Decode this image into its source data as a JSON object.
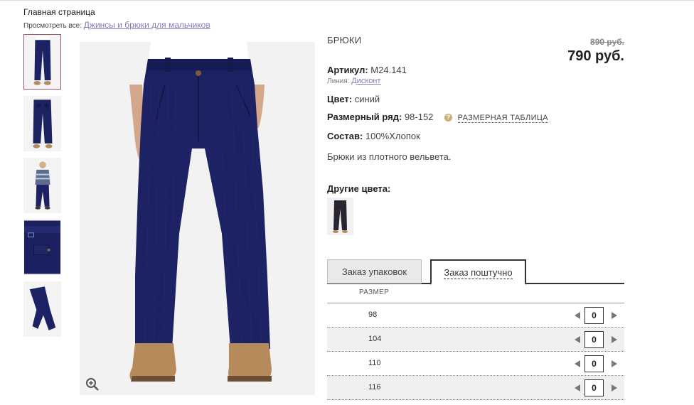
{
  "breadcrumb": {
    "home": "Главная страница"
  },
  "view_all": {
    "label": "Просмотреть все:",
    "link": "Джинсы и брюки для мальчиков"
  },
  "product": {
    "category": "БРЮКИ",
    "old_price": "890 руб.",
    "price": "790 руб.",
    "article_label": "Артикул:",
    "article_value": "M24.141",
    "line_label": "Линия:",
    "line_value": "Дисконт",
    "color_label": "Цвет:",
    "color_value": "синий",
    "size_label": "Размерный ряд:",
    "size_value": "98-152",
    "size_help_icon": "?",
    "size_table_link": "РАЗМЕРНАЯ ТАБЛИЦА",
    "composition_label": "Состав:",
    "composition_value": "100%Хлопок",
    "description": "Брюки из плотного вельвета.",
    "other_colors_title": "Другие цвета:"
  },
  "order": {
    "tabs": [
      "Заказ упаковок",
      "Заказ поштучно"
    ],
    "active_tab": 1,
    "size_header": "РАЗМЕР",
    "rows": [
      {
        "size": "98",
        "qty": "0"
      },
      {
        "size": "104",
        "qty": "0"
      },
      {
        "size": "110",
        "qty": "0"
      },
      {
        "size": "116",
        "qty": "0"
      }
    ]
  },
  "colors": {
    "pants": "#1c2263",
    "accent_link": "#8a79b8",
    "active_thumb_border": "#a0536f",
    "help_badge": "#c8ad74"
  }
}
